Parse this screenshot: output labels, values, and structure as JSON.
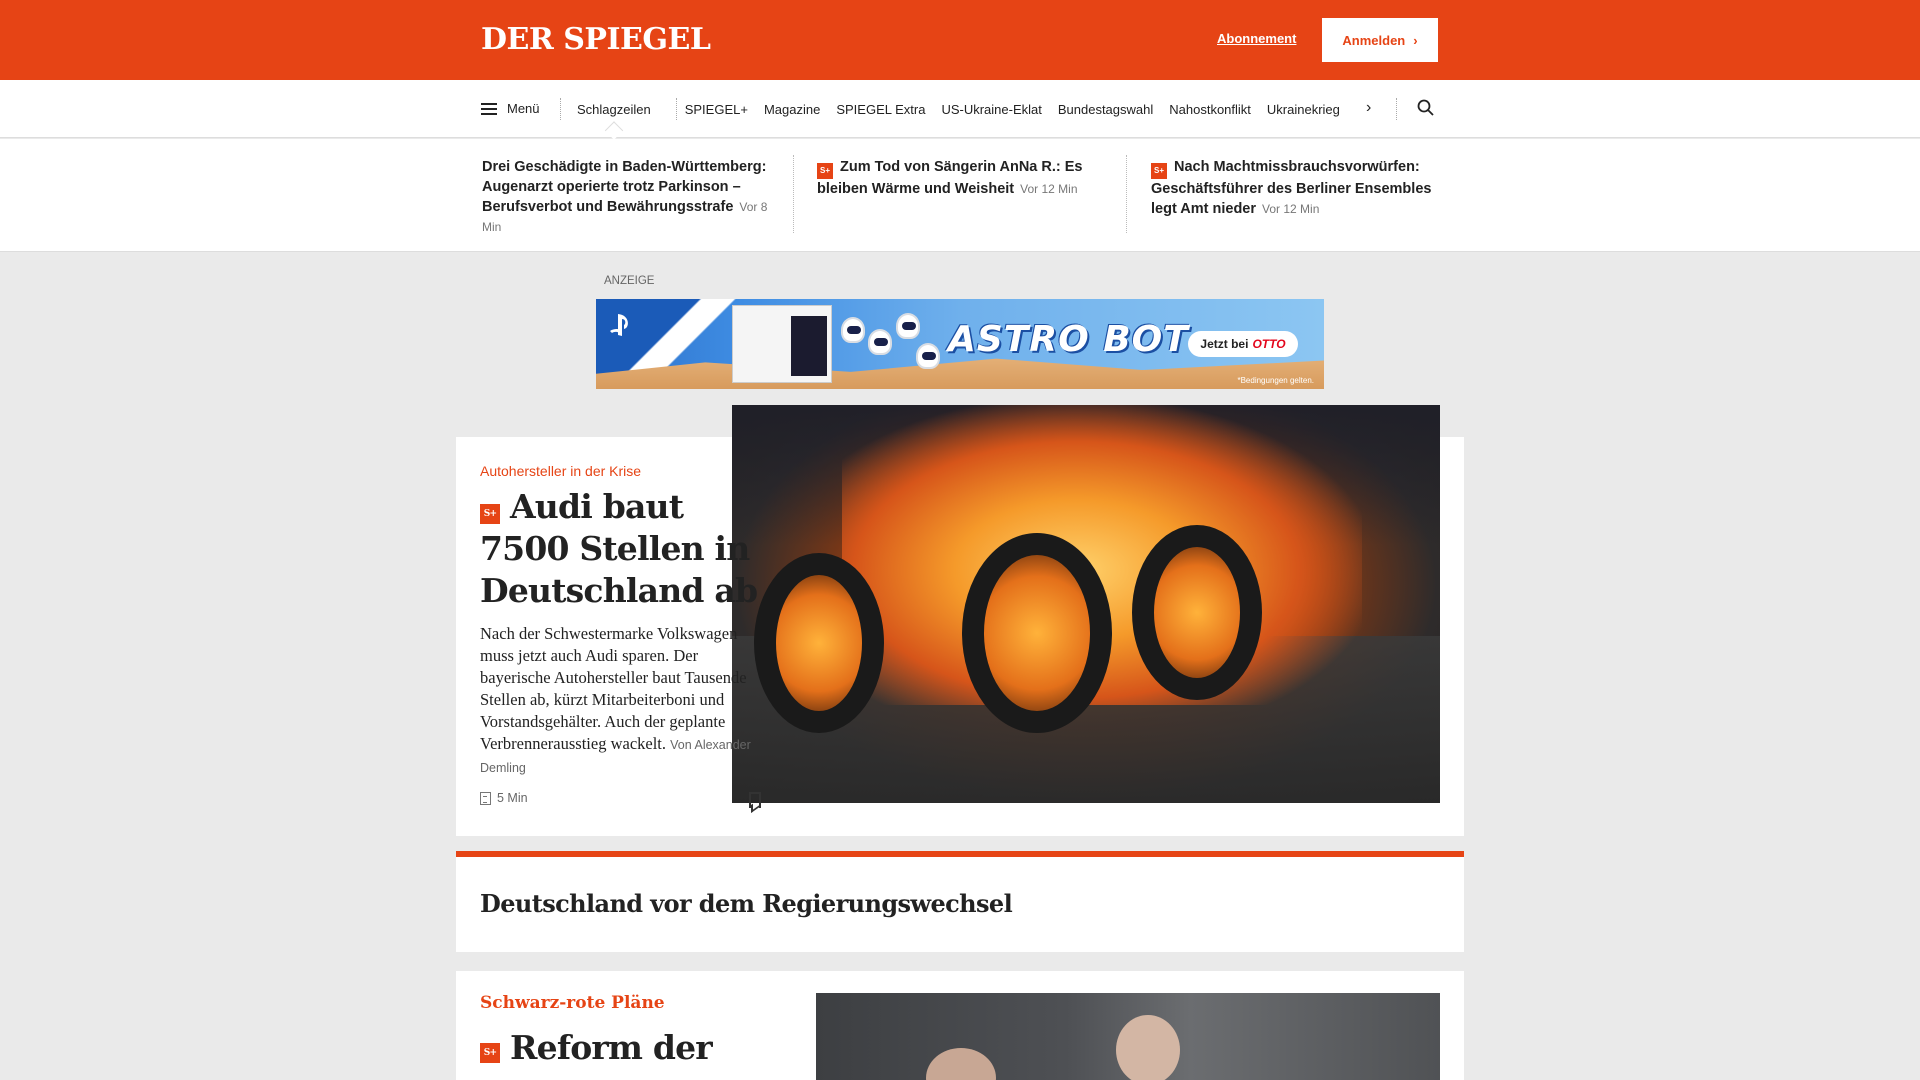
{
  "header": {
    "logo": "DER SPIEGEL",
    "subscription_label": "Abonnement",
    "login_label": "Anmelden",
    "login_chevron": "›",
    "accent_color": "#e64415"
  },
  "nav": {
    "menu_label": "Menü",
    "items": [
      "Schlagzeilen",
      "SPIEGEL+",
      "Magazine",
      "SPIEGEL Extra",
      "US-Ukraine-Eklat",
      "Bundestagswahl",
      "Nahostkonflikt",
      "Ukrainekrieg"
    ],
    "more_icon": "›",
    "search_icon": "search-icon"
  },
  "ticker": [
    {
      "plus": false,
      "title": "Drei Geschädigte in Baden-Württemberg: Augenarzt operierte trotz Parkinson – Berufsverbot und Bewährungsstrafe",
      "time": "Vor 8 Min"
    },
    {
      "plus": true,
      "title": "Zum Tod von Sängerin AnNa R.: Es bleiben Wärme und Weisheit",
      "time": "Vor 12 Min"
    },
    {
      "plus": true,
      "title": "Nach Machtmissbrauchsvorwürfen: Geschäftsführer des Berliner Ensembles legt Amt nieder",
      "time": "Vor 12 Min"
    }
  ],
  "splus_label": "S+",
  "ad": {
    "label": "ANZEIGE",
    "headline": "ASTRO BOT",
    "cta_prefix": "Jetzt bei",
    "cta_brand": "OTTO",
    "fine_print": "*Bedingungen gelten."
  },
  "lead": {
    "kicker": "Autohersteller in der Krise",
    "title": "Audi baut 7500 Stellen in Deutschland ab",
    "teaser": "Nach der Schwestermarke Volkswagen muss jetzt auch Audi sparen. Der bayerische Autohersteller baut Tausende Stellen ab, kürzt Mitarbeiterboni und Vorstandsgehälter. Auch der geplante Verbrennerausstieg wackelt.",
    "byline": "Von Alexander Demling",
    "reading_time": "5 Min"
  },
  "section": {
    "title": "Deutschland vor dem Regierungswechsel"
  },
  "second": {
    "kicker": "Schwarz-rote Pläne",
    "title": "Reform der"
  }
}
